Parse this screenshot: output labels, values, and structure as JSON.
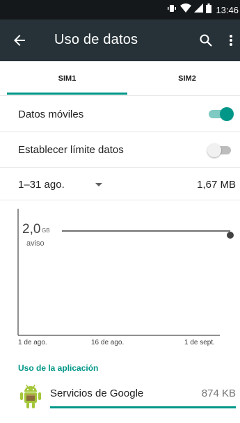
{
  "status_bar": {
    "time": "13:46"
  },
  "app_bar": {
    "title": "Uso de datos"
  },
  "tabs": [
    {
      "label": "SIM1",
      "selected": true
    },
    {
      "label": "SIM2",
      "selected": false
    }
  ],
  "settings": {
    "mobile_data": {
      "label": "Datos móviles",
      "enabled": true
    },
    "set_limit": {
      "label": "Establecer límite datos",
      "enabled": false
    }
  },
  "cycle": {
    "label": "1–31 ago.",
    "total": "1,67 MB"
  },
  "chart_data": {
    "type": "line",
    "x_ticks": [
      "1 de ago.",
      "16 de ago.",
      "1 de sept."
    ],
    "warning": {
      "value": "2,0",
      "unit": "GB",
      "label": "aviso"
    }
  },
  "app_usage": {
    "header": "Uso de la aplicación",
    "items": [
      {
        "name": "Servicios de Google",
        "size": "874 KB",
        "fraction": 1.0
      }
    ]
  },
  "colors": {
    "accent": "#009688",
    "app_bar": "#263238",
    "status_bar": "#15181a",
    "android_green": "#a4c639"
  }
}
